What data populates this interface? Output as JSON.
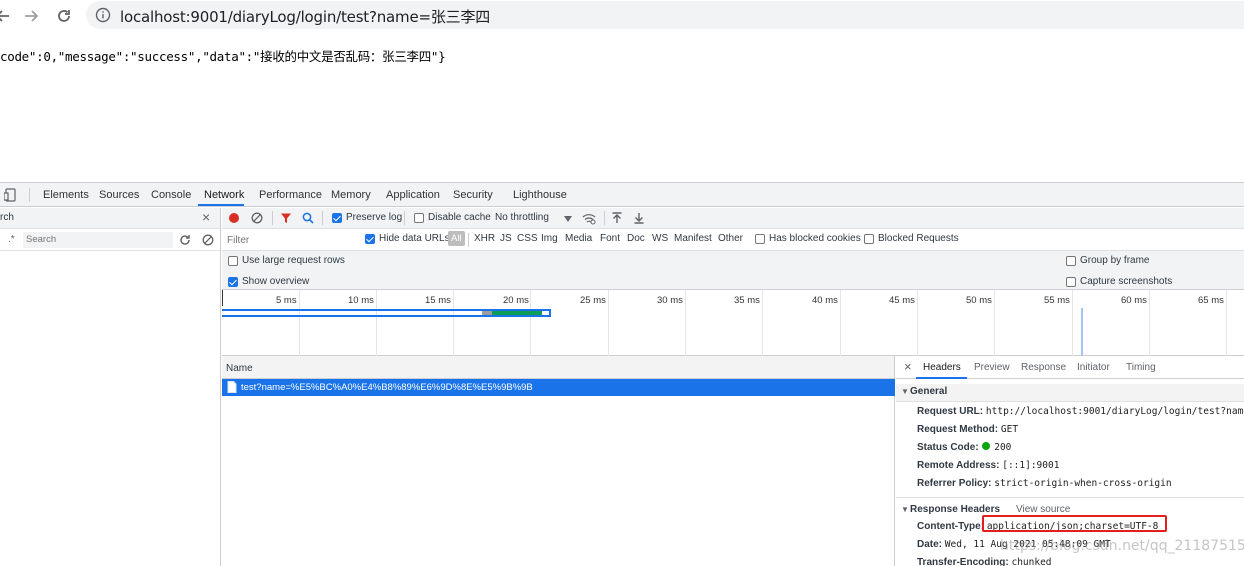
{
  "browser": {
    "url": "localhost:9001/diaryLog/login/test?name=张三李四"
  },
  "page": {
    "body_text": "code\":0,\"message\":\"success\",\"data\":\"接收的中文是否乱码：张三李四\"}"
  },
  "devtools": {
    "tabs": [
      "Elements",
      "Sources",
      "Console",
      "Network",
      "Performance",
      "Memory",
      "Application",
      "Security",
      "Lighthouse"
    ],
    "active_tab": "Network",
    "left": {
      "search_label": "rch",
      "search_placeholder": "Search",
      "regex_label": ".*"
    },
    "toolbar": {
      "preserve_log": "Preserve log",
      "disable_cache": "Disable cache",
      "throttling": "No throttling"
    },
    "filter_bar": {
      "placeholder": "Filter",
      "hide_data_urls": "Hide data URLs",
      "types": [
        "All",
        "XHR",
        "JS",
        "CSS",
        "Img",
        "Media",
        "Font",
        "Doc",
        "WS",
        "Manifest",
        "Other"
      ],
      "has_blocked_cookies": "Has blocked cookies",
      "blocked_requests": "Blocked Requests"
    },
    "options": {
      "large_rows": "Use large request rows",
      "show_overview": "Show overview",
      "group_by_frame": "Group by frame",
      "capture_screenshots": "Capture screenshots"
    },
    "timeline_ticks": [
      "5 ms",
      "10 ms",
      "15 ms",
      "20 ms",
      "25 ms",
      "30 ms",
      "35 ms",
      "40 ms",
      "45 ms",
      "50 ms",
      "55 ms",
      "60 ms",
      "65 ms"
    ],
    "request_list": {
      "header": "Name",
      "rows": [
        "test?name=%E5%BC%A0%E4%B8%89%E6%9D%8E%E5%9B%9B"
      ]
    },
    "details": {
      "close": "×",
      "tabs": [
        "Headers",
        "Preview",
        "Response",
        "Initiator",
        "Timing"
      ],
      "general_title": "General",
      "general": [
        {
          "k": "Request URL:",
          "v": "http://localhost:9001/diaryLog/login/test?name=%E5"
        },
        {
          "k": "Request Method:",
          "v": "GET"
        },
        {
          "k": "Status Code:",
          "v": "200"
        },
        {
          "k": "Remote Address:",
          "v": "[::1]:9001"
        },
        {
          "k": "Referrer Policy:",
          "v": "strict-origin-when-cross-origin"
        }
      ],
      "response_title": "Response Headers",
      "view_source": "View source",
      "response": [
        {
          "k": "Content-Type:",
          "v": "application/json;charset=UTF-8"
        },
        {
          "k": "Date:",
          "v": "Wed, 11 Aug 2021 05:48:09 GMT"
        },
        {
          "k": "Transfer-Encoding:",
          "v": "chunked"
        }
      ],
      "status_color": "#0ca40c"
    }
  },
  "watermark": "https://blog.csdn.net/qq_21187515"
}
